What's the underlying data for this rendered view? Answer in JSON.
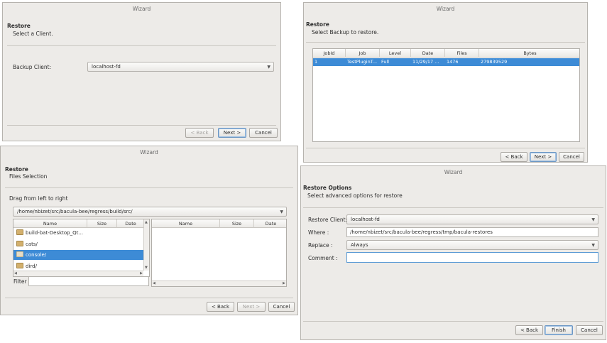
{
  "w1": {
    "title": "Wizard",
    "heading": "Restore",
    "subheading": "Select a Client.",
    "client_label": "Backup Client:",
    "client_value": "localhost-fd",
    "back": "< Back",
    "next": "Next >",
    "cancel": "Cancel"
  },
  "w2": {
    "title": "Wizard",
    "heading": "Restore",
    "subheading": "Select Backup to restore.",
    "columns": [
      "JobId",
      "Job",
      "Level",
      "Date",
      "Files",
      "Bytes"
    ],
    "row": [
      "1",
      "TestPluginT...",
      "Full",
      "11/29/17 ...",
      "1476",
      "279839529"
    ],
    "back": "< Back",
    "next": "Next >",
    "cancel": "Cancel"
  },
  "w3": {
    "title": "Wizard",
    "heading": "Restore",
    "subheading": "Files Selection",
    "drag_label": "Drag from left to right",
    "path": "/home/nbizet/src/bacula-bee/regress/build/src/",
    "left_columns": [
      "Name",
      "Size",
      "Date"
    ],
    "right_columns": [
      "Name",
      "Size",
      "Date"
    ],
    "files": [
      "build-bat-Desktop_Qt...",
      "cats/",
      "console/",
      "dird/"
    ],
    "filter_label": "Filter",
    "back": "< Back",
    "next": "Next >",
    "cancel": "Cancel"
  },
  "w4": {
    "title": "Wizard",
    "heading": "Restore Options",
    "subheading": "Select advanced options for restore",
    "client_label": "Restore Client:",
    "client_value": "localhost-fd",
    "where_label": "Where :",
    "where_value": "/home/nbizet/src/bacula-bee/regress/tmp/bacula-restores",
    "replace_label": "Replace :",
    "replace_value": "Always",
    "comment_label": "Comment :",
    "comment_value": "",
    "back": "< Back",
    "finish": "Finish",
    "cancel": "Cancel"
  }
}
